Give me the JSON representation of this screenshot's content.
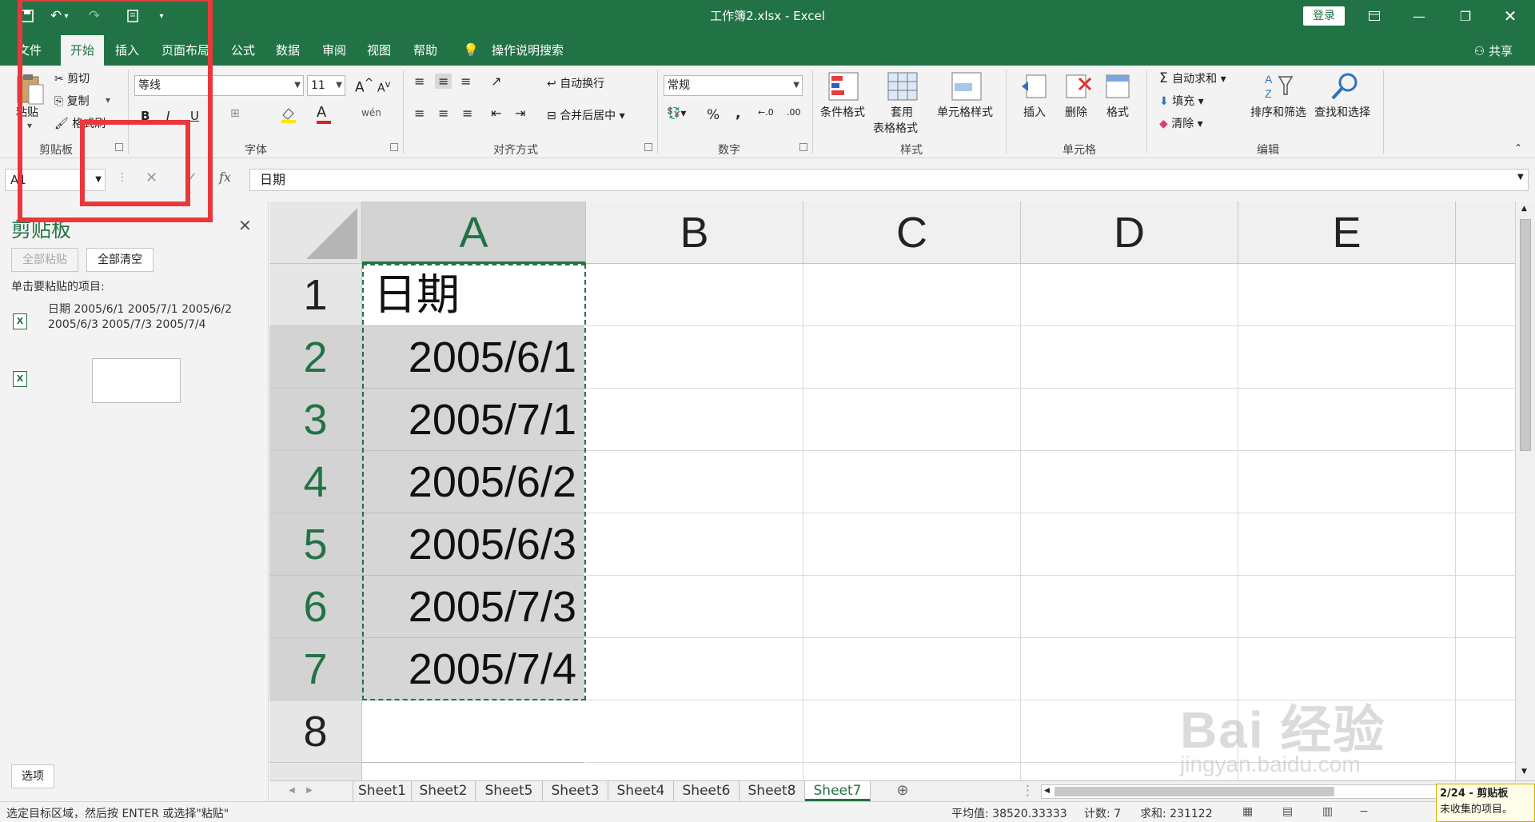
{
  "titlebar": {
    "title": "工作簿2.xlsx  -  Excel",
    "login": "登录"
  },
  "tabs": [
    "文件",
    "开始",
    "插入",
    "页面布局",
    "公式",
    "数据",
    "审阅",
    "视图",
    "帮助",
    "操作说明搜索"
  ],
  "share": "共享",
  "ribbon": {
    "clipboard": {
      "paste": "粘贴",
      "cut": "剪切",
      "copy": "复制",
      "format_painter": "格式刷",
      "label": "剪贴板"
    },
    "font": {
      "name": "等线",
      "size": "11",
      "bold": "B",
      "italic": "I",
      "underline": "U",
      "label": "字体",
      "inc": "A",
      "dec": "A",
      "wen": "wén"
    },
    "align": {
      "wrap": "自动换行",
      "merge": "合并后居中",
      "label": "对齐方式"
    },
    "number": {
      "format": "常规",
      "percent": "%",
      "comma": ",",
      "inc_dec": ".00\n→.0",
      "label": "数字"
    },
    "styles": {
      "cond": "条件格式",
      "table1": "套用",
      "table2": "表格格式",
      "cell_style": "单元格样式",
      "label": "样式"
    },
    "cells": {
      "insert": "插入",
      "delete": "删除",
      "format": "格式",
      "label": "单元格"
    },
    "edit": {
      "autosum": "自动求和",
      "fill": "填充",
      "clear": "清除",
      "sort": "排序和筛选",
      "find": "查找和选择",
      "label": "编辑"
    }
  },
  "formula_bar": {
    "name_box": "A1",
    "fx": "fx",
    "content": "日期"
  },
  "clipboard_pane": {
    "title": "剪贴板",
    "paste_all": "全部粘贴",
    "clear_all": "全部清空",
    "hint": "单击要粘贴的项目:",
    "item1": "日期 2005/6/1 2005/7/1 2005/6/2 2005/6/3 2005/7/3 2005/7/4",
    "options": "选项"
  },
  "grid": {
    "columns": [
      "A",
      "B",
      "C",
      "D",
      "E"
    ],
    "rows": [
      "1",
      "2",
      "3",
      "4",
      "5",
      "6",
      "7",
      "8"
    ],
    "colA": [
      "日期",
      "2005/6/1",
      "2005/7/1",
      "2005/6/2",
      "2005/6/3",
      "2005/7/3",
      "2005/7/4",
      ""
    ]
  },
  "sheets": [
    "Sheet1",
    "Sheet2",
    "Sheet5",
    "Sheet3",
    "Sheet4",
    "Sheet6",
    "Sheet8",
    "Sheet7"
  ],
  "active_sheet": "Sheet7",
  "status": {
    "left": "选定目标区域，然后按 ENTER 或选择\"粘贴\"",
    "avg": "平均值: 38520.33333",
    "count": "计数: 7",
    "sum": "求和: 231122"
  },
  "clip_notice": {
    "line1": "2/24 - 剪贴板",
    "line2": "未收集的项目。"
  },
  "watermark": {
    "main": "Bai 经验",
    "sub": "jingyan.baidu.com"
  },
  "colors": {
    "excel_green": "#217346",
    "annotation_red": "#e8383c"
  }
}
